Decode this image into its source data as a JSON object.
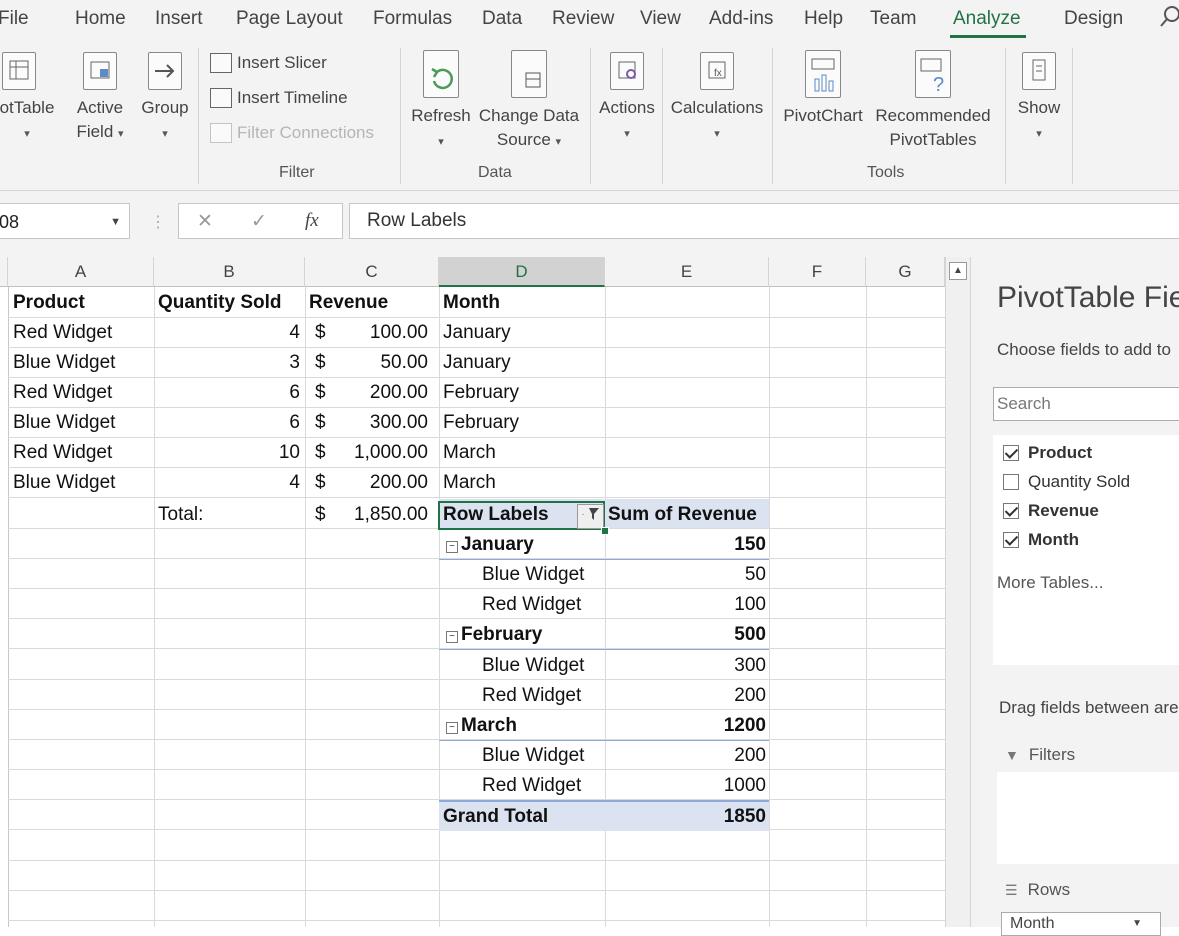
{
  "menu": {
    "tabs": [
      "File",
      "Home",
      "Insert",
      "Page Layout",
      "Formulas",
      "Data",
      "Review",
      "View",
      "Add-ins",
      "Help",
      "Team",
      "Analyze",
      "Design"
    ],
    "active_tab": "Analyze"
  },
  "ribbon": {
    "pivottable_label": "otTable",
    "active_field_label_1": "Active",
    "active_field_label_2": "Field",
    "group_label": "Group",
    "insert_slicer": "Insert Slicer",
    "insert_timeline": "Insert Timeline",
    "filter_connections": "Filter Connections",
    "filter_group": "Filter",
    "refresh_label": "Refresh",
    "change_data_1": "Change Data",
    "change_data_2": "Source",
    "data_group": "Data",
    "actions_label": "Actions",
    "calculations_label": "Calculations",
    "pivotchart_label": "PivotChart",
    "recommended_1": "Recommended",
    "recommended_2": "PivotTables",
    "tools_group": "Tools",
    "show_label": "Show"
  },
  "formula_bar": {
    "name_box": "08",
    "fx": "fx",
    "cancel": "✕",
    "enter": "✓",
    "content": "Row Labels"
  },
  "columns": [
    "A",
    "B",
    "C",
    "D",
    "E",
    "F",
    "G"
  ],
  "selected_column": "D",
  "source_table": {
    "headers": [
      "Product",
      "Quantity Sold",
      "Revenue",
      "Month"
    ],
    "rows": [
      {
        "product": "Red Widget",
        "qty": "4",
        "cur": "$",
        "rev": "100.00",
        "month": "January"
      },
      {
        "product": "Blue Widget",
        "qty": "3",
        "cur": "$",
        "rev": "50.00",
        "month": "January"
      },
      {
        "product": "Red Widget",
        "qty": "6",
        "cur": "$",
        "rev": "200.00",
        "month": "February"
      },
      {
        "product": "Blue Widget",
        "qty": "6",
        "cur": "$",
        "rev": "300.00",
        "month": "February"
      },
      {
        "product": "Red Widget",
        "qty": "10",
        "cur": "$",
        "rev": "1,000.00",
        "month": "March"
      },
      {
        "product": "Blue Widget",
        "qty": "4",
        "cur": "$",
        "rev": "200.00",
        "month": "March"
      }
    ],
    "total_label": "Total:",
    "total_cur": "$",
    "total_value": "1,850.00"
  },
  "pivot": {
    "row_labels": "Row Labels",
    "value_header": "Sum of Revenue",
    "groups": [
      {
        "month": "January",
        "total": "150",
        "items": [
          {
            "name": "Blue Widget",
            "value": "50"
          },
          {
            "name": "Red Widget",
            "value": "100"
          }
        ]
      },
      {
        "month": "February",
        "total": "500",
        "items": [
          {
            "name": "Blue Widget",
            "value": "300"
          },
          {
            "name": "Red Widget",
            "value": "200"
          }
        ]
      },
      {
        "month": "March",
        "total": "1200",
        "items": [
          {
            "name": "Blue Widget",
            "value": "200"
          },
          {
            "name": "Red Widget",
            "value": "1000"
          }
        ]
      }
    ],
    "grand_total_label": "Grand Total",
    "grand_total_value": "1850",
    "collapse_glyph": "−"
  },
  "pivot_panel": {
    "title": "PivotTable Fie",
    "subtitle": "Choose fields to add to",
    "search_placeholder": "Search",
    "fields": [
      {
        "name": "Product",
        "checked": true
      },
      {
        "name": "Quantity Sold",
        "checked": false
      },
      {
        "name": "Revenue",
        "checked": true
      },
      {
        "name": "Month",
        "checked": true
      }
    ],
    "more_tables": "More Tables...",
    "drag_hint": "Drag fields between are",
    "filters_label": "Filters",
    "rows_label": "Rows",
    "rows_item": "Month"
  },
  "colors": {
    "accent": "#217346",
    "pivot_header": "#dbe3f1",
    "pivot_line": "#8ea9db"
  }
}
